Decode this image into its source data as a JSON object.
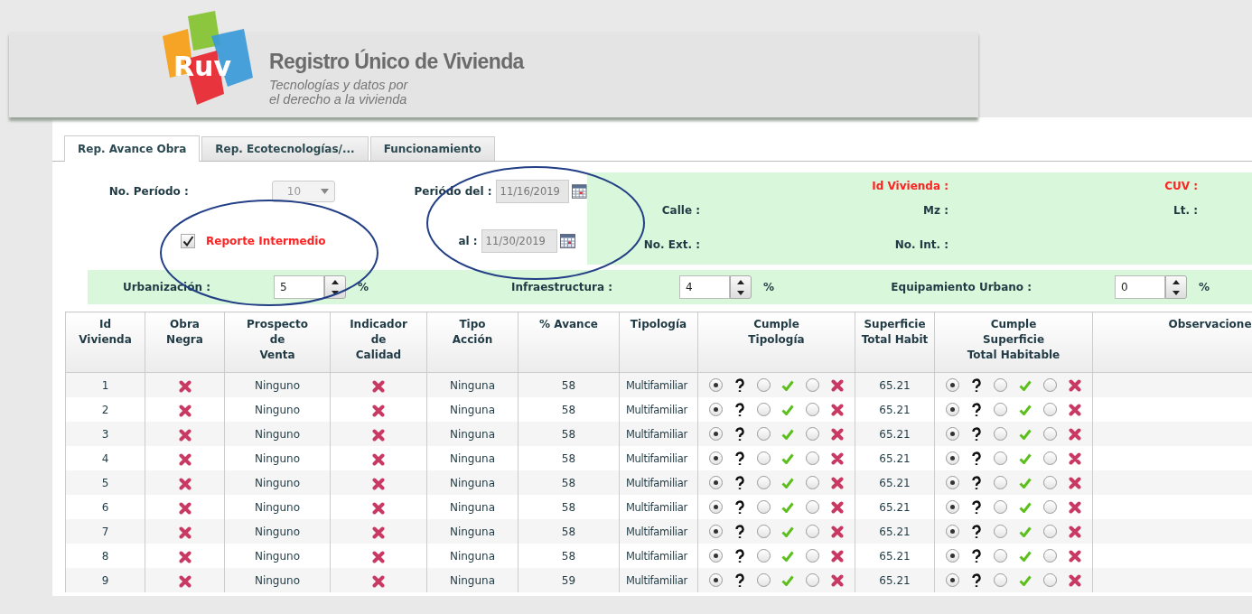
{
  "header": {
    "logo_text": "Ruv",
    "title": "Registro Único de Vivienda",
    "tagline_1": "Tecnologías y datos por",
    "tagline_2": "el derecho a la vivienda"
  },
  "tabs": [
    {
      "label": "Rep. Avance Obra",
      "selected": true
    },
    {
      "label": "Rep. Ecotecnologías/...",
      "selected": false
    },
    {
      "label": "Funcionamiento",
      "selected": false
    }
  ],
  "form": {
    "periodo_label": "No. Período :",
    "periodo": {
      "value": "10",
      "disabled": true
    },
    "periodo_del_label": "Periódo del :",
    "fecha_del": {
      "value": "11/16/2019",
      "disabled": true
    },
    "al_label": "al :",
    "fecha_al": {
      "value": "11/30/2019",
      "disabled": true
    },
    "reporte_intermedio": {
      "label": "Reporte Intermedio",
      "checked": true
    }
  },
  "vivienda_info": [
    {
      "label": "Id Vivienda :",
      "kind": "required"
    },
    {
      "label": "CUV :",
      "kind": "required"
    },
    {
      "label": "Calle :",
      "kind": "normal"
    },
    {
      "label": "Mz :",
      "kind": "normal"
    },
    {
      "label": "Lt. :",
      "kind": "normal"
    },
    {
      "label": "No. Ext. :",
      "kind": "normal"
    },
    {
      "label": "No. Int. :",
      "kind": "normal"
    }
  ],
  "percentages": [
    {
      "label": "Urbanización :",
      "value": "5",
      "unit": "%"
    },
    {
      "label": "Infraestructura :",
      "value": "4",
      "unit": "%"
    },
    {
      "label": "Equipamiento Urbano :",
      "value": "0",
      "unit": "%"
    }
  ],
  "table": {
    "columns": [
      [
        "Id",
        "Vivienda"
      ],
      [
        "Obra",
        "Negra"
      ],
      [
        "Prospecto",
        "de",
        "Venta"
      ],
      [
        "Indicador",
        "de",
        "Calidad"
      ],
      [
        "Tipo",
        "Acción"
      ],
      [
        "% Avance"
      ],
      [
        "Tipología"
      ],
      [
        "Cumple",
        "Tipología"
      ],
      [
        "Superficie",
        "Total Habit"
      ],
      [
        "Cumple",
        "Superficie",
        "Total Habitable"
      ],
      [
        "Observacione"
      ]
    ],
    "rows": [
      {
        "id": "1",
        "obra_negra": false,
        "prospecto": "Ninguno",
        "indicador_calidad": false,
        "tipo_accion": "Ninguna",
        "avance": "58",
        "tipologia": "Multifamiliar",
        "cumple_tipologia": [
          {
            "kind": "unknown",
            "selected": true
          },
          {
            "kind": "yes",
            "selected": false
          },
          {
            "kind": "no",
            "selected": false
          }
        ],
        "superficie": "65.21",
        "cumple_superficie": [
          {
            "kind": "unknown",
            "selected": true
          },
          {
            "kind": "yes",
            "selected": false
          },
          {
            "kind": "no",
            "selected": false
          }
        ]
      },
      {
        "id": "2",
        "obra_negra": false,
        "prospecto": "Ninguno",
        "indicador_calidad": false,
        "tipo_accion": "Ninguna",
        "avance": "58",
        "tipologia": "Multifamiliar",
        "cumple_tipologia": [
          {
            "kind": "unknown",
            "selected": true
          },
          {
            "kind": "yes",
            "selected": false
          },
          {
            "kind": "no",
            "selected": false
          }
        ],
        "superficie": "65.21",
        "cumple_superficie": [
          {
            "kind": "unknown",
            "selected": true
          },
          {
            "kind": "yes",
            "selected": false
          },
          {
            "kind": "no",
            "selected": false
          }
        ]
      },
      {
        "id": "3",
        "obra_negra": false,
        "prospecto": "Ninguno",
        "indicador_calidad": false,
        "tipo_accion": "Ninguna",
        "avance": "58",
        "tipologia": "Multifamiliar",
        "cumple_tipologia": [
          {
            "kind": "unknown",
            "selected": true
          },
          {
            "kind": "yes",
            "selected": false
          },
          {
            "kind": "no",
            "selected": false
          }
        ],
        "superficie": "65.21",
        "cumple_superficie": [
          {
            "kind": "unknown",
            "selected": true
          },
          {
            "kind": "yes",
            "selected": false
          },
          {
            "kind": "no",
            "selected": false
          }
        ]
      },
      {
        "id": "4",
        "obra_negra": false,
        "prospecto": "Ninguno",
        "indicador_calidad": false,
        "tipo_accion": "Ninguna",
        "avance": "58",
        "tipologia": "Multifamiliar",
        "cumple_tipologia": [
          {
            "kind": "unknown",
            "selected": true
          },
          {
            "kind": "yes",
            "selected": false
          },
          {
            "kind": "no",
            "selected": false
          }
        ],
        "superficie": "65.21",
        "cumple_superficie": [
          {
            "kind": "unknown",
            "selected": true
          },
          {
            "kind": "yes",
            "selected": false
          },
          {
            "kind": "no",
            "selected": false
          }
        ]
      },
      {
        "id": "5",
        "obra_negra": false,
        "prospecto": "Ninguno",
        "indicador_calidad": false,
        "tipo_accion": "Ninguna",
        "avance": "58",
        "tipologia": "Multifamiliar",
        "cumple_tipologia": [
          {
            "kind": "unknown",
            "selected": true
          },
          {
            "kind": "yes",
            "selected": false
          },
          {
            "kind": "no",
            "selected": false
          }
        ],
        "superficie": "65.21",
        "cumple_superficie": [
          {
            "kind": "unknown",
            "selected": true
          },
          {
            "kind": "yes",
            "selected": false
          },
          {
            "kind": "no",
            "selected": false
          }
        ]
      },
      {
        "id": "6",
        "obra_negra": false,
        "prospecto": "Ninguno",
        "indicador_calidad": false,
        "tipo_accion": "Ninguna",
        "avance": "58",
        "tipologia": "Multifamiliar",
        "cumple_tipologia": [
          {
            "kind": "unknown",
            "selected": true
          },
          {
            "kind": "yes",
            "selected": false
          },
          {
            "kind": "no",
            "selected": false
          }
        ],
        "superficie": "65.21",
        "cumple_superficie": [
          {
            "kind": "unknown",
            "selected": true
          },
          {
            "kind": "yes",
            "selected": false
          },
          {
            "kind": "no",
            "selected": false
          }
        ]
      },
      {
        "id": "7",
        "obra_negra": false,
        "prospecto": "Ninguno",
        "indicador_calidad": false,
        "tipo_accion": "Ninguna",
        "avance": "58",
        "tipologia": "Multifamiliar",
        "cumple_tipologia": [
          {
            "kind": "unknown",
            "selected": true
          },
          {
            "kind": "yes",
            "selected": false
          },
          {
            "kind": "no",
            "selected": false
          }
        ],
        "superficie": "65.21",
        "cumple_superficie": [
          {
            "kind": "unknown",
            "selected": true
          },
          {
            "kind": "yes",
            "selected": false
          },
          {
            "kind": "no",
            "selected": false
          }
        ]
      },
      {
        "id": "8",
        "obra_negra": false,
        "prospecto": "Ninguno",
        "indicador_calidad": false,
        "tipo_accion": "Ninguna",
        "avance": "58",
        "tipologia": "Multifamiliar",
        "cumple_tipologia": [
          {
            "kind": "unknown",
            "selected": true
          },
          {
            "kind": "yes",
            "selected": false
          },
          {
            "kind": "no",
            "selected": false
          }
        ],
        "superficie": "65.21",
        "cumple_superficie": [
          {
            "kind": "unknown",
            "selected": true
          },
          {
            "kind": "yes",
            "selected": false
          },
          {
            "kind": "no",
            "selected": false
          }
        ]
      },
      {
        "id": "9",
        "obra_negra": false,
        "prospecto": "Ninguno",
        "indicador_calidad": false,
        "tipo_accion": "Ninguna",
        "avance": "59",
        "tipologia": "Multifamiliar",
        "cumple_tipologia": [
          {
            "kind": "unknown",
            "selected": true
          },
          {
            "kind": "yes",
            "selected": false
          },
          {
            "kind": "no",
            "selected": false
          }
        ],
        "superficie": "65.21",
        "cumple_superficie": [
          {
            "kind": "unknown",
            "selected": true
          },
          {
            "kind": "yes",
            "selected": false
          },
          {
            "kind": "no",
            "selected": false
          }
        ]
      }
    ]
  },
  "markup": [
    {
      "kind": "ellipse"
    },
    {
      "kind": "ellipse"
    }
  ]
}
